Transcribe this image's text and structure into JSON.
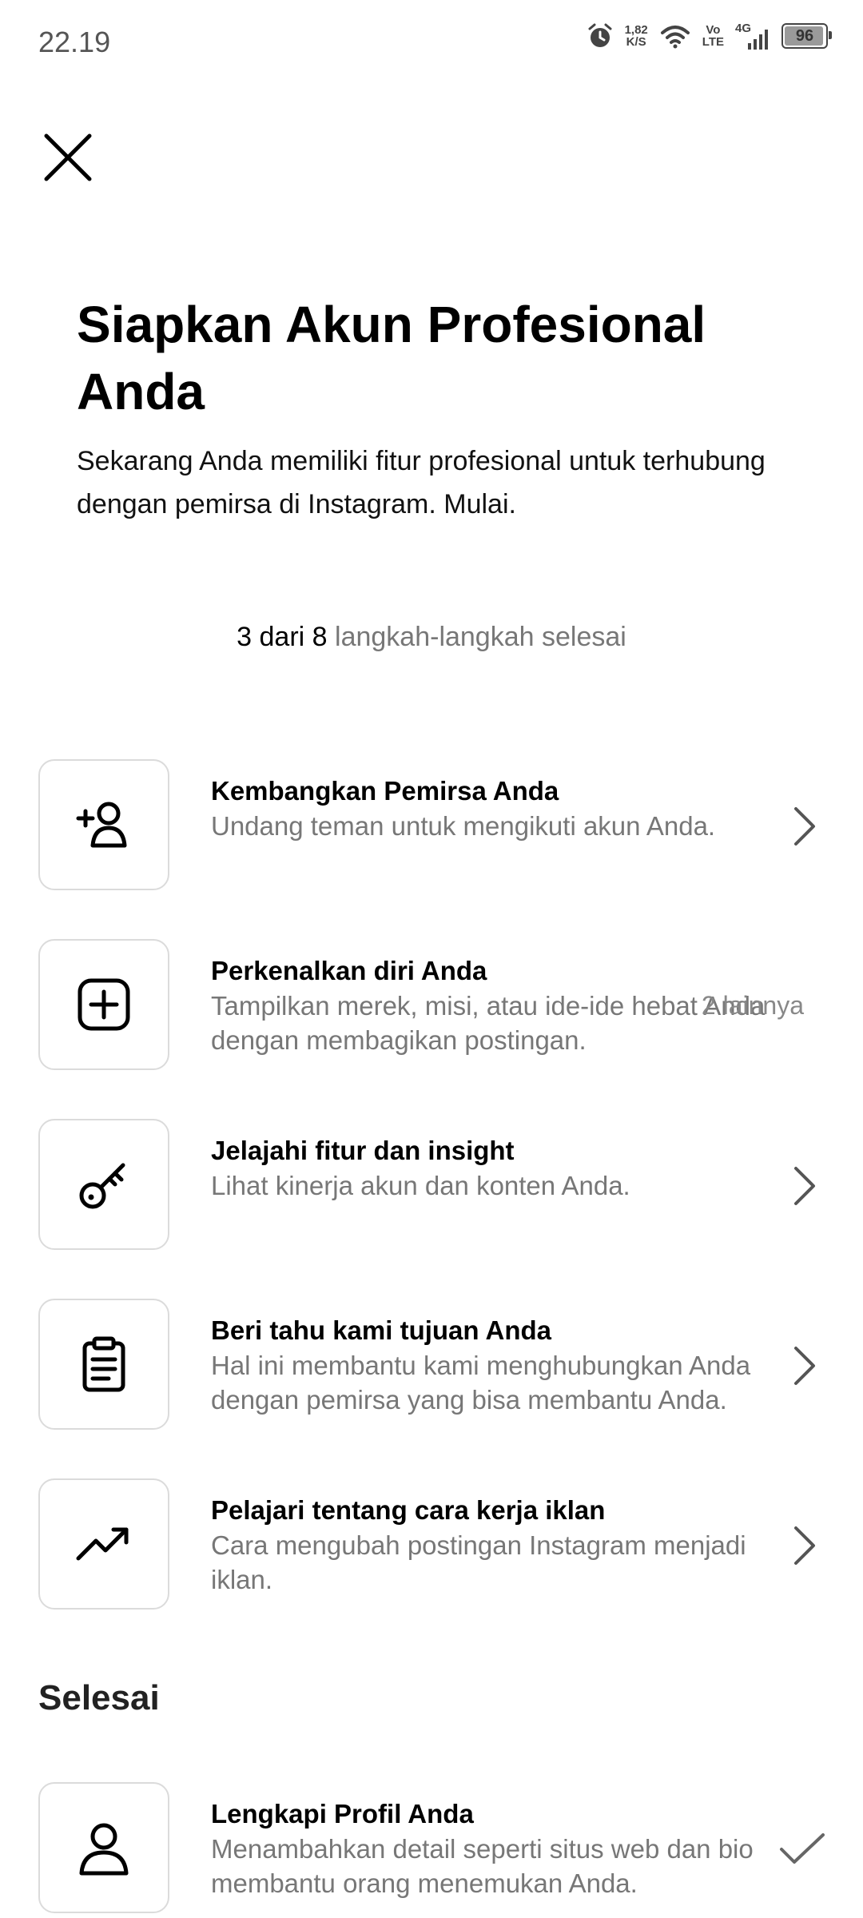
{
  "status_bar": {
    "time": "22.19",
    "net_speed_value": "1,82",
    "net_speed_unit": "K/S",
    "volte_top": "Vo",
    "volte_bottom": "LTE",
    "network": "4G",
    "battery": "96",
    "battery_level_percent": 96
  },
  "header": {
    "title": "Siapkan Akun Profesional Anda",
    "subtitle": "Sekarang Anda memiliki fitur profesional untuk terhubung dengan pemirsa di Instagram. Mulai."
  },
  "progress": {
    "done_text": "3 dari 8",
    "rest_text": "langkah-langkah selesai"
  },
  "steps": [
    {
      "icon": "add-person-icon",
      "title": "Kembangkan Pemirsa Anda",
      "description": "Undang teman untuk mengikuti akun Anda."
    },
    {
      "icon": "add-post-icon",
      "title": "Perkenalkan diri Anda",
      "description": "Tampilkan merek, misi, atau ide-ide hebat Anda dengan membagikan postingan.",
      "overlay": "2 lainnya"
    },
    {
      "icon": "key-icon",
      "title": "Jelajahi fitur dan insight",
      "description": "Lihat kinerja akun dan konten Anda."
    },
    {
      "icon": "clipboard-icon",
      "title": "Beri tahu kami tujuan Anda",
      "description": "Hal ini membantu kami menghubungkan Anda dengan pemirsa yang bisa membantu Anda."
    },
    {
      "icon": "trending-up-icon",
      "title": "Pelajari tentang cara kerja iklan",
      "description": "Cara mengubah postingan Instagram menjadi iklan."
    }
  ],
  "completed_section": {
    "title": "Selesai",
    "items": [
      {
        "icon": "person-icon",
        "title": "Lengkapi Profil Anda",
        "description": "Menambahkan detail seperti situs web dan bio membantu orang menemukan Anda."
      }
    ]
  }
}
